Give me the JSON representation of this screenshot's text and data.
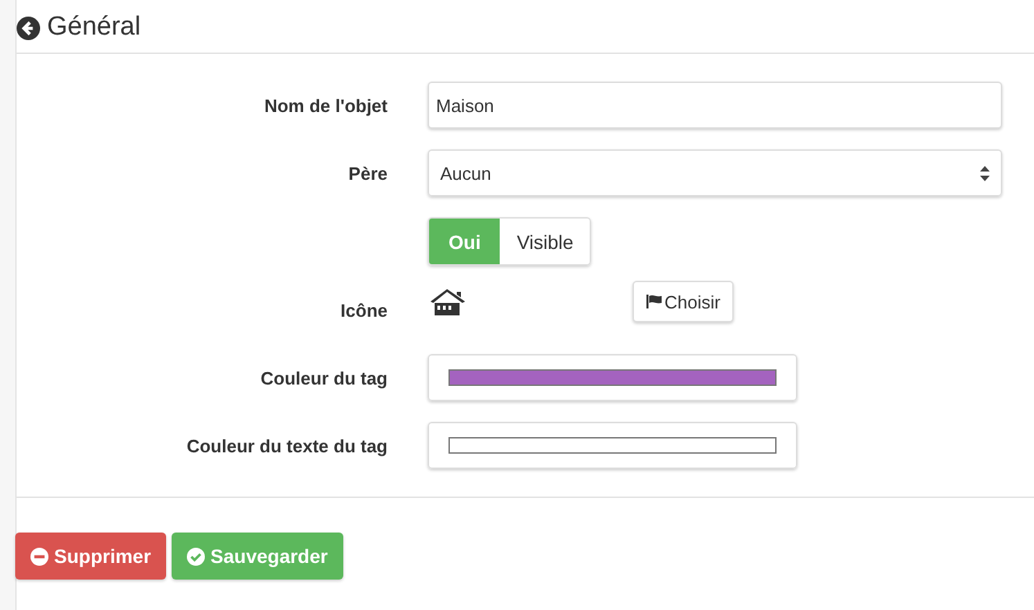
{
  "title": "Général",
  "fields": [
    {
      "kind": "text",
      "label": "Nom de l'objet",
      "value": "Maison"
    },
    {
      "kind": "select",
      "label": "Père",
      "value": "Aucun"
    },
    {
      "kind": "toggle",
      "on": true,
      "on_label": "Oui",
      "text": "Visible"
    },
    {
      "kind": "icon",
      "label": "Icône",
      "button": "Choisir"
    },
    {
      "kind": "color",
      "label": "Couleur du tag",
      "color": "#a463bf"
    },
    {
      "kind": "color",
      "label": "Couleur du texte du tag",
      "color": "#ffffff"
    }
  ],
  "buttons": [
    {
      "kind": "danger",
      "label": "Supprimer"
    },
    {
      "kind": "success",
      "label": "Sauvegarder"
    }
  ]
}
